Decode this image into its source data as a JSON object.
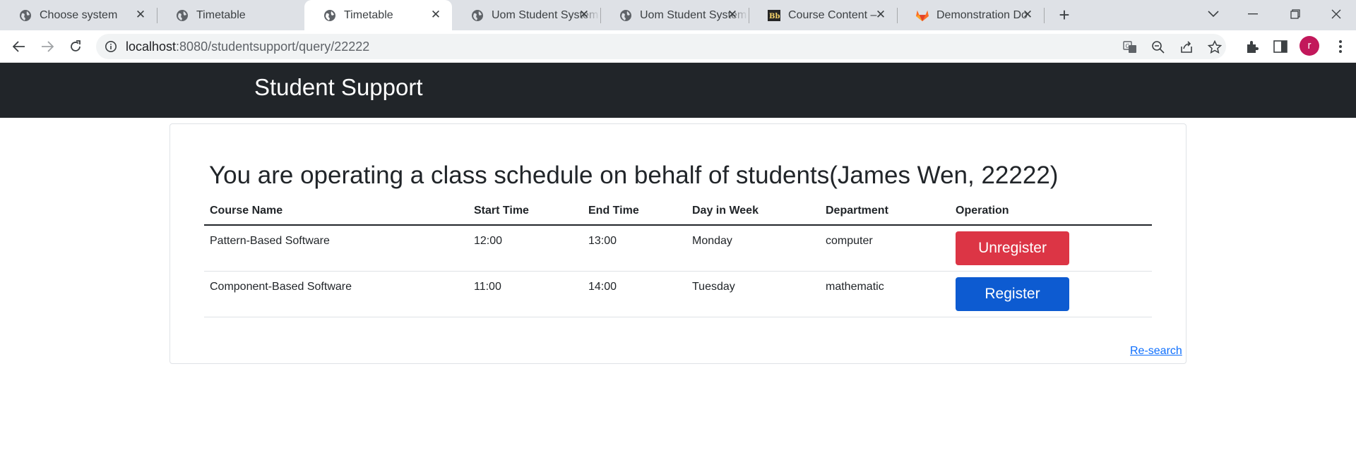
{
  "browser": {
    "tabs": [
      {
        "title": "Choose system",
        "favicon": "globe-icon",
        "active": false
      },
      {
        "title": "Timetable",
        "favicon": "globe-icon",
        "active": false
      },
      {
        "title": "Timetable",
        "favicon": "globe-icon",
        "active": true
      },
      {
        "title": "Uom Student System",
        "favicon": "globe-icon",
        "active": false
      },
      {
        "title": "Uom Student System",
        "favicon": "globe-icon",
        "active": false
      },
      {
        "title": "Course Content –",
        "favicon": "blackboard-icon",
        "active": false
      },
      {
        "title": "Demonstration Do",
        "favicon": "gitlab-icon",
        "active": false
      }
    ],
    "url_host": "localhost",
    "url_rest": ":8080/studentsupport/query/22222",
    "profile_initial": "r"
  },
  "navbar": {
    "brand": "Student Support",
    "bg_color": "#212529"
  },
  "main": {
    "heading": "You are operating a class schedule on behalf of students(James Wen, 22222)",
    "columns": [
      "Course Name",
      "Start Time",
      "End Time",
      "Day in Week",
      "Department",
      "Operation"
    ],
    "rows": [
      {
        "course": "Pattern-Based Software",
        "start": "12:00",
        "end": "13:00",
        "day": "Monday",
        "department": "computer",
        "action": "Unregister",
        "action_color": "#dc3545"
      },
      {
        "course": "Component-Based Software",
        "start": "11:00",
        "end": "14:00",
        "day": "Tuesday",
        "department": "mathematic",
        "action": "Register",
        "action_color": "#0d5bd1"
      }
    ],
    "research_link": "Re-search"
  }
}
